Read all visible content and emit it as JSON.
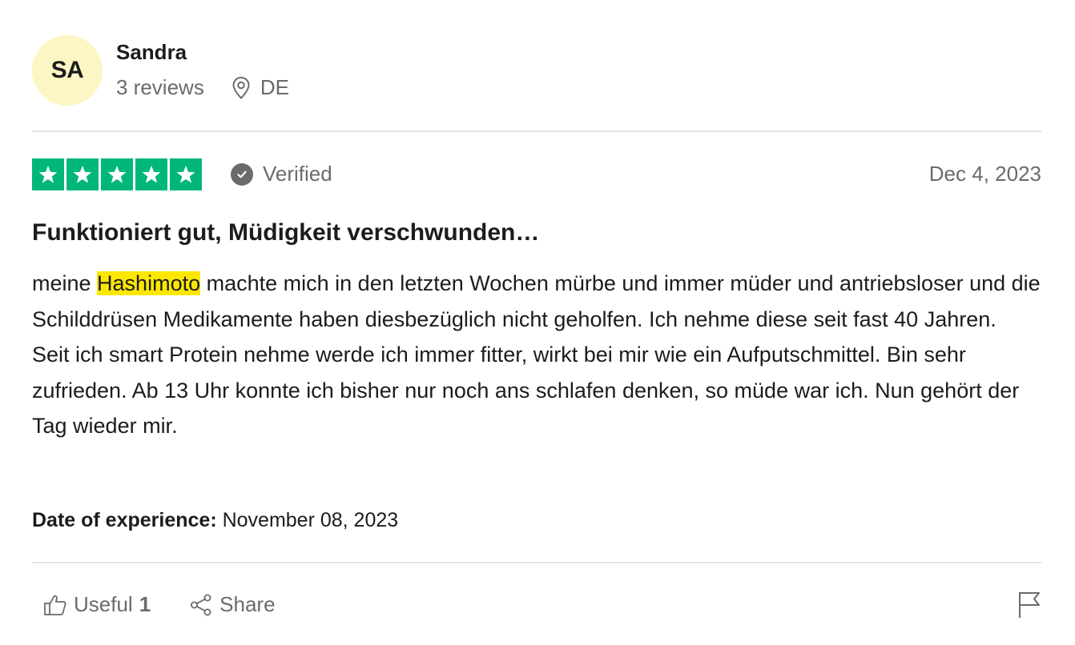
{
  "reviewer": {
    "initials": "SA",
    "name": "Sandra",
    "reviews_count": "3 reviews",
    "country": "DE"
  },
  "review": {
    "rating": 5,
    "verified_label": "Verified",
    "date": "Dec 4, 2023",
    "title": "Funktioniert gut, Müdigkeit verschwunden…",
    "text_intro": "meine ",
    "text_highlight": "Hashimoto",
    "text_rest": " machte mich in den letzten Wochen mürbe und immer müder und antriebsloser und die Schilddrüsen Medikamente haben diesbezüglich nicht geholfen. Ich nehme diese seit fast 40 Jahren.",
    "text_para2": "Seit ich smart Protein nehme werde ich immer fitter, wirkt bei mir wie ein Aufputschmittel. Bin sehr zufrieden. Ab 13 Uhr konnte ich bisher nur noch ans schlafen denken, so müde war ich. Nun gehört der Tag wieder mir.",
    "experience_label": "Date of experience:",
    "experience_date": "November 08, 2023"
  },
  "actions": {
    "useful_label": "Useful",
    "useful_count": "1",
    "share_label": "Share"
  },
  "colors": {
    "star_green": "#00b67a",
    "avatar_bg": "#fcf6c4",
    "highlight": "#fbe700",
    "muted_text": "#6b6b6b"
  },
  "icons": {
    "location": "location-pin-icon",
    "verified": "check-circle-icon",
    "useful": "thumbs-up-icon",
    "share": "share-icon",
    "report": "flag-icon",
    "star": "star-icon"
  }
}
